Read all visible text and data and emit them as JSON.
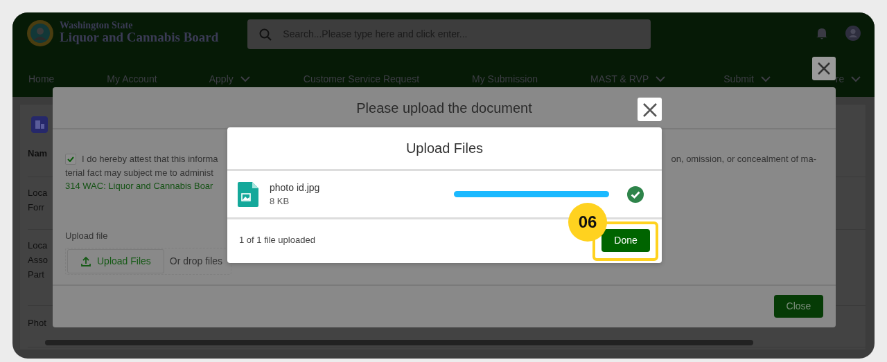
{
  "header": {
    "logo_line1": "Washington State",
    "logo_line2": "Liquor and Cannabis Board",
    "search": {
      "placeholder": "Search...Please type here and click enter..."
    }
  },
  "nav": [
    {
      "label": "Home",
      "dropdown": false
    },
    {
      "label": "My Account",
      "dropdown": false
    },
    {
      "label": "Apply",
      "dropdown": true
    },
    {
      "label": "Customer Service Request",
      "dropdown": false
    },
    {
      "label": "My Submission",
      "dropdown": false
    },
    {
      "label": "MAST & RVP",
      "dropdown": true
    },
    {
      "label": "Submit",
      "dropdown": true
    },
    {
      "label": "re",
      "dropdown": true
    }
  ],
  "page": {
    "rows": [
      {
        "kind": "header",
        "lines": [
          "Nam"
        ]
      },
      {
        "kind": "data",
        "lines": [
          "Loca",
          "Forr"
        ]
      },
      {
        "kind": "data",
        "lines": [
          "Loca",
          "Asso",
          "Part"
        ]
      },
      {
        "kind": "data",
        "lines": [
          "Phot"
        ]
      }
    ]
  },
  "document_modal": {
    "title": "Please upload the document",
    "attestation": {
      "checked": true,
      "line1_start": "I do hereby attest that this informa",
      "line1_end": "on, omission, or concealment of ma-",
      "line2_start": "terial fact may subject me to administ",
      "link": "314 WAC: Liquor and Cannabis Boar"
    },
    "upload_label": "Upload file",
    "upload_button": "Upload Files",
    "drop_text": "Or drop files",
    "close_button": "Close"
  },
  "upload_modal": {
    "title": "Upload Files",
    "files": [
      {
        "name": "photo id.jpg",
        "size": "8 KB",
        "level": 1,
        "done": true
      }
    ],
    "status": "1 of 1 file uploaded",
    "done_button": "Done"
  },
  "callout": {
    "step": "06"
  }
}
